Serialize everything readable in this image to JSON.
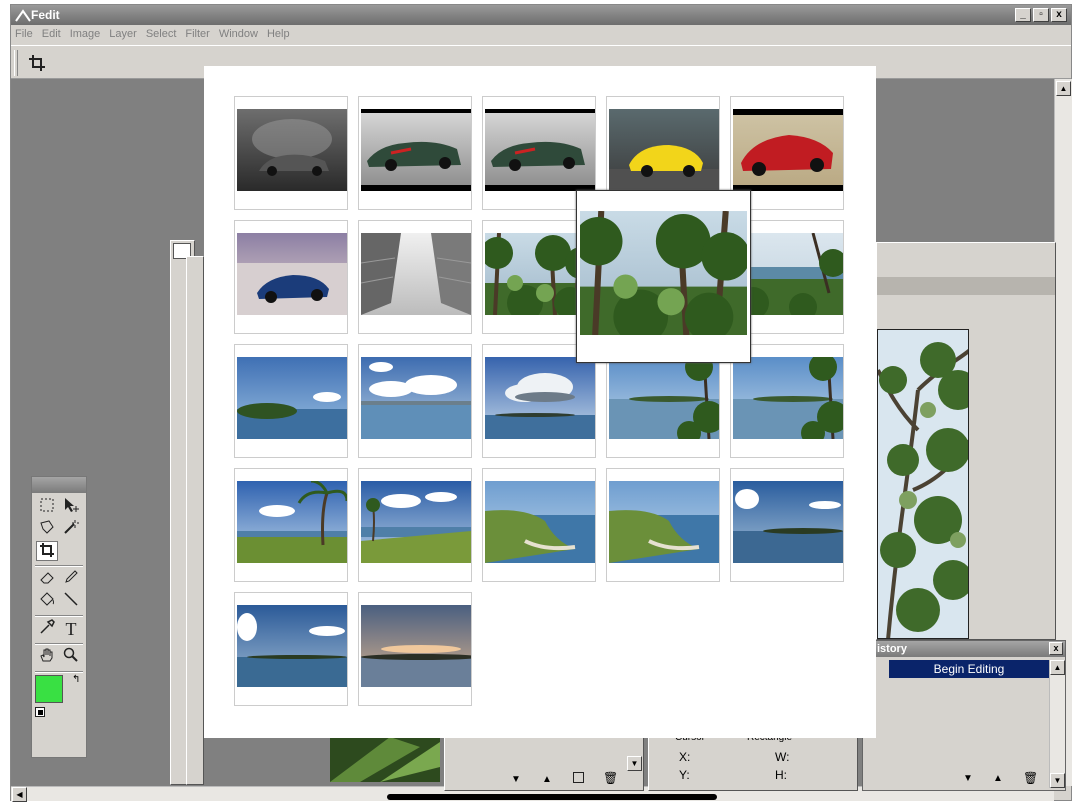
{
  "app": {
    "title": "Fedit",
    "window_buttons": [
      "_",
      "▫",
      "x"
    ]
  },
  "menu": [
    "File",
    "Edit",
    "Image",
    "Layer",
    "Select",
    "Filter",
    "Window",
    "Help"
  ],
  "toolbar": {
    "active_tool_icon": "crop-icon"
  },
  "toolbox": {
    "tools": [
      "rect-select-icon",
      "move-icon",
      "lasso-icon",
      "magic-wand-icon",
      "crop-icon",
      "eraser-icon",
      "pencil-icon",
      "paint-bucket-icon",
      "line-icon",
      "eyedropper-icon",
      "text-icon",
      "hand-icon",
      "zoom-icon"
    ],
    "text_tool_label": "T",
    "foreground_color": "#39e043",
    "background_color": "#000000"
  },
  "history": {
    "title": "istory",
    "items": [
      "Begin Editing"
    ]
  },
  "info": {
    "cursor_label": "Cursor",
    "rect_label": "Rectangle",
    "x_label": "X:",
    "y_label": "Y:",
    "w_label": "W:",
    "h_label": "H:"
  },
  "gallery": {
    "thumbnails": [
      {
        "kind": "car-silver-studio"
      },
      {
        "kind": "car-green-studio"
      },
      {
        "kind": "car-green-studio"
      },
      {
        "kind": "car-yellow"
      },
      {
        "kind": "car-red"
      },
      {
        "kind": "car-blue-desert"
      },
      {
        "kind": "building-bw"
      },
      {
        "kind": "jungle"
      },
      {
        "kind": "jungle"
      },
      {
        "kind": "jungle-sea"
      },
      {
        "kind": "seascape-island"
      },
      {
        "kind": "seascape-clouds"
      },
      {
        "kind": "seascape-storm-cloud"
      },
      {
        "kind": "seascape-trees"
      },
      {
        "kind": "seascape-trees"
      },
      {
        "kind": "palm-beach"
      },
      {
        "kind": "palm-beach-2"
      },
      {
        "kind": "coast-cliff"
      },
      {
        "kind": "coast-cliff"
      },
      {
        "kind": "seascape-calm"
      },
      {
        "kind": "seascape-calm-2"
      },
      {
        "kind": "sunset-sea"
      }
    ],
    "hover_preview": {
      "kind": "jungle"
    }
  }
}
